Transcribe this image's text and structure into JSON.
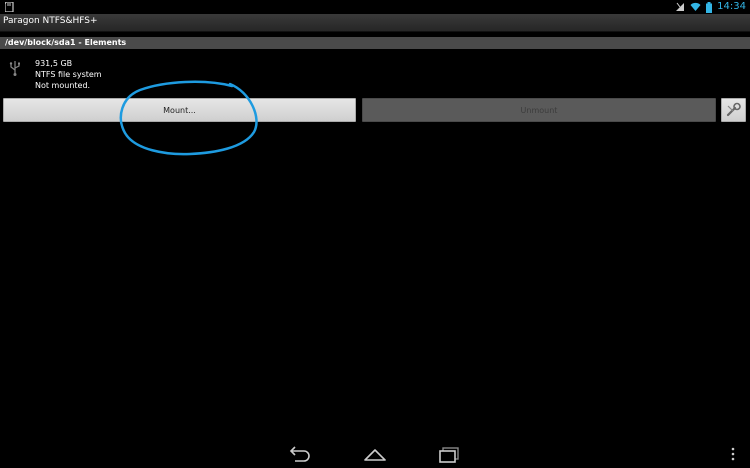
{
  "status_bar": {
    "time": "14:34",
    "icons": [
      "sdcard-notification-icon",
      "signal-icon",
      "wifi-icon",
      "battery-icon"
    ]
  },
  "app": {
    "title": "Paragon NTFS&HFS+"
  },
  "path_header": {
    "text": "/dev/block/sda1 - Elements"
  },
  "device": {
    "icon": "usb-icon",
    "size": "931,5 GB",
    "filesystem": "NTFS file system",
    "state": "Not mounted."
  },
  "actions": {
    "mount_label": "Mount...",
    "unmount_label": "Unmount",
    "tools_icon": "wrench-icon"
  },
  "nav": {
    "icons": [
      "back-icon",
      "home-icon",
      "recent-apps-icon",
      "overflow-menu-icon"
    ]
  },
  "colors": {
    "accent": "#33b5e5",
    "annotation": "#1e9be0",
    "background": "#000000"
  }
}
